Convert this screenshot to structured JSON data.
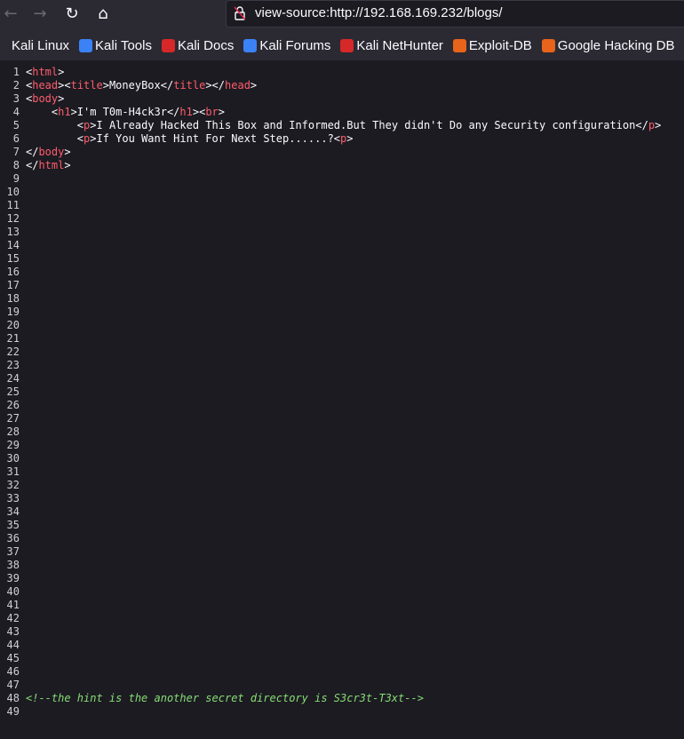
{
  "browser": {
    "url": "view-source:http://192.168.169.232/blogs/",
    "bookmarks": [
      {
        "label": "Kali Linux",
        "icon": "kali-dragon-icon",
        "color": "#d0d0d0"
      },
      {
        "label": "Kali Tools",
        "icon": "kali-tools-icon",
        "color": "#3b82f6"
      },
      {
        "label": "Kali Docs",
        "icon": "kali-docs-icon",
        "color": "#d62828"
      },
      {
        "label": "Kali Forums",
        "icon": "kali-forums-icon",
        "color": "#3b82f6"
      },
      {
        "label": "Kali NetHunter",
        "icon": "nethunter-icon",
        "color": "#d62828"
      },
      {
        "label": "Exploit-DB",
        "icon": "exploit-db-icon",
        "color": "#e8641b"
      },
      {
        "label": "Google Hacking DB",
        "icon": "ghdb-icon",
        "color": "#e8641b"
      }
    ]
  },
  "source": {
    "total_lines": 49,
    "lines": {
      "1": [
        [
          "p",
          "<"
        ],
        [
          "t",
          "html"
        ],
        [
          "p",
          ">"
        ]
      ],
      "2": [
        [
          "p",
          "<"
        ],
        [
          "t",
          "head"
        ],
        [
          "p",
          "><"
        ],
        [
          "t",
          "title"
        ],
        [
          "p",
          ">MoneyBox</"
        ],
        [
          "t",
          "title"
        ],
        [
          "p",
          "></"
        ],
        [
          "t",
          "head"
        ],
        [
          "p",
          ">"
        ]
      ],
      "3": [
        [
          "p",
          "<"
        ],
        [
          "t",
          "body"
        ],
        [
          "p",
          ">"
        ]
      ],
      "4": [
        [
          "p",
          "    <"
        ],
        [
          "t",
          "h1"
        ],
        [
          "p",
          ">I'm T0m-H4ck3r</"
        ],
        [
          "t",
          "h1"
        ],
        [
          "p",
          "><"
        ],
        [
          "t",
          "br"
        ],
        [
          "p",
          ">"
        ]
      ],
      "5": [
        [
          "p",
          "        <"
        ],
        [
          "t",
          "p"
        ],
        [
          "p",
          ">I Already Hacked This Box and Informed.But They didn't Do any Security configuration</"
        ],
        [
          "t",
          "p"
        ],
        [
          "p",
          ">"
        ]
      ],
      "6": [
        [
          "p",
          "        <"
        ],
        [
          "t",
          "p"
        ],
        [
          "p",
          ">If You Want Hint For Next Step......?<"
        ],
        [
          "t",
          "p"
        ],
        [
          "p",
          ">"
        ]
      ],
      "7": [
        [
          "p",
          "</"
        ],
        [
          "t",
          "body"
        ],
        [
          "p",
          ">"
        ]
      ],
      "8": [
        [
          "p",
          "</"
        ],
        [
          "t",
          "html"
        ],
        [
          "p",
          ">"
        ]
      ],
      "48": [
        [
          "c",
          "<!--the hint is the another secret directory is S3cr3t-T3xt-->"
        ]
      ]
    }
  }
}
